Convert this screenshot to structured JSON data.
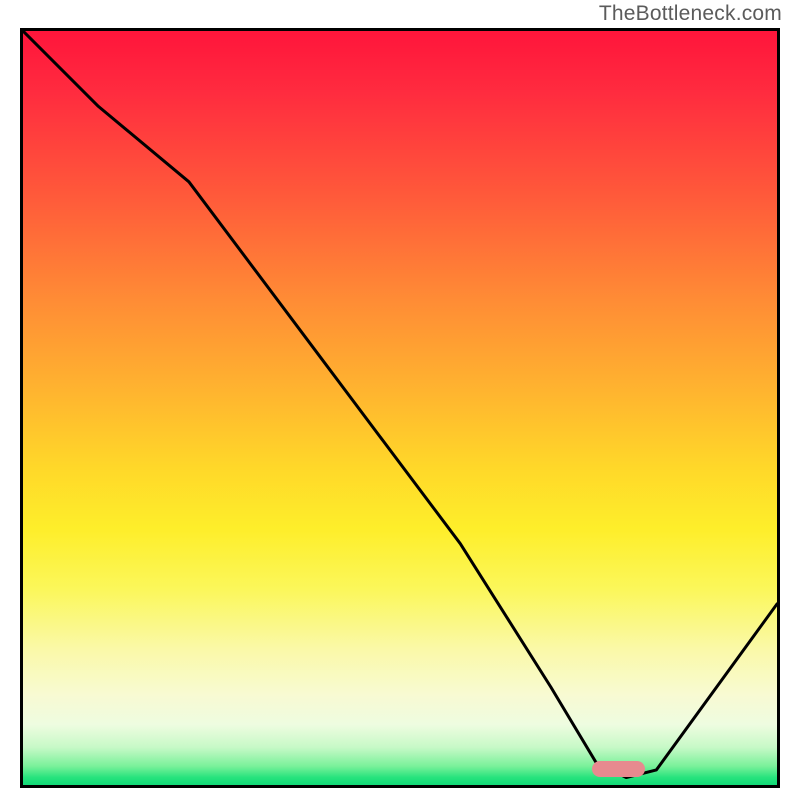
{
  "attribution": "TheBottleneck.com",
  "chart_data": {
    "type": "line",
    "title": "",
    "xlabel": "",
    "ylabel": "",
    "xlim": [
      0,
      100
    ],
    "ylim": [
      0,
      100
    ],
    "grid": false,
    "legend": false,
    "background": "red-yellow-green vertical gradient (bottleneck heatmap)",
    "series": [
      {
        "name": "bottleneck-curve",
        "x": [
          0,
          10,
          22,
          40,
          58,
          70,
          76,
          80,
          84,
          100
        ],
        "values": [
          100,
          90,
          80,
          56,
          32,
          13,
          3,
          1,
          2,
          24
        ]
      }
    ],
    "optimal_marker": {
      "x_center": 79,
      "width_pct": 7
    }
  }
}
